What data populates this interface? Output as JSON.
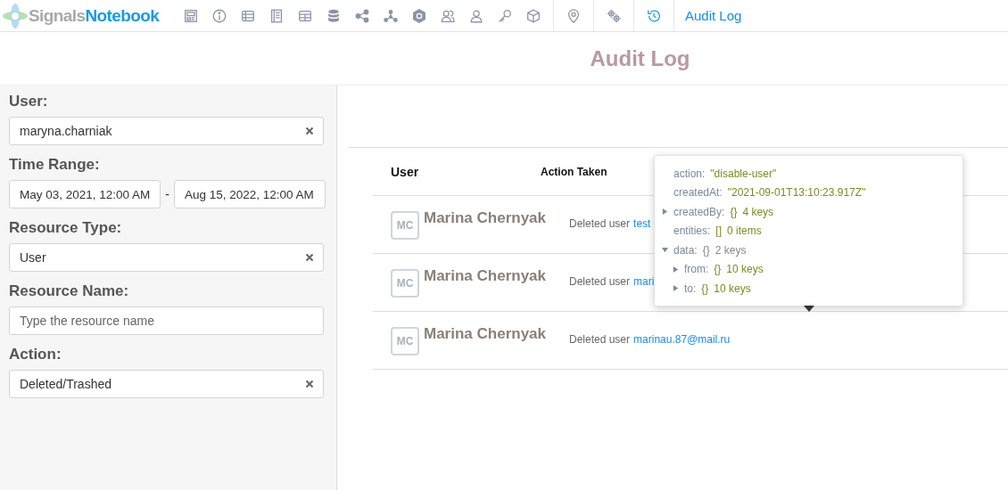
{
  "app": {
    "logo_first": "Signals",
    "logo_second": "Notebook",
    "current_page": "Audit Log"
  },
  "page_title": "Audit Log",
  "filters": [
    {
      "label": "User:",
      "kind": "clearable",
      "value": "maryna.charniak"
    },
    {
      "label": "Time Range:",
      "kind": "range",
      "from": "May 03, 2021, 12:00 AM",
      "to": "Aug 15, 2022, 12:00 AM",
      "separator": "-"
    },
    {
      "label": "Resource Type:",
      "kind": "clearable",
      "value": "User"
    },
    {
      "label": "Resource Name:",
      "kind": "text",
      "placeholder": "Type the resource name"
    },
    {
      "label": "Action:",
      "kind": "clearable",
      "value": "Deleted/Trashed"
    }
  ],
  "table": {
    "columns": [
      "User",
      "Action Taken"
    ],
    "rows": [
      {
        "initials": "MC",
        "user": "Marina Chernyak",
        "action": "Deleted user",
        "target": "test"
      },
      {
        "initials": "MC",
        "user": "Marina Chernyak",
        "action": "Deleted user",
        "target": "mari"
      },
      {
        "initials": "MC",
        "user": "Marina Chernyak",
        "action": "Deleted user",
        "target": "marinau.87@mail.ru"
      }
    ]
  },
  "popover": {
    "entries": [
      {
        "key": "action:",
        "value": "\"disable-user\""
      },
      {
        "key": "createdAt:",
        "value": "\"2021-09-01T13:10:23.917Z\""
      },
      {
        "key": "createdBy:",
        "brace": "{}",
        "summary": "4 keys",
        "expanded": false
      },
      {
        "key": "entities:",
        "brace": "[]",
        "summary": "0 items"
      },
      {
        "key": "data:",
        "brace": "{}",
        "summary": "2 keys",
        "expanded": true,
        "children": [
          {
            "key": "from:",
            "brace": "{}",
            "summary": "10 keys",
            "expanded": false
          },
          {
            "key": "to:",
            "brace": "{}",
            "summary": "10 keys",
            "expanded": false
          }
        ]
      }
    ]
  }
}
